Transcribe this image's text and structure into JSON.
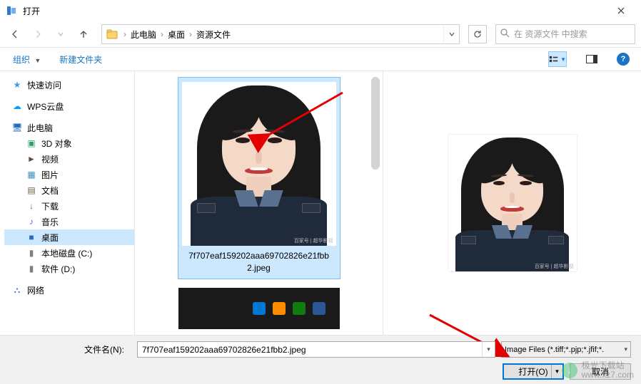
{
  "titlebar": {
    "title": "打开"
  },
  "nav": {
    "breadcrumb": [
      "此电脑",
      "桌面",
      "资源文件"
    ],
    "search_placeholder": "在 资源文件 中搜索"
  },
  "toolbar": {
    "organize": "组织",
    "new_folder": "新建文件夹"
  },
  "sidebar": {
    "items": [
      {
        "label": "快速访问",
        "color": "#3b9ae1",
        "glyph": "★",
        "level": 1
      },
      {
        "label": "WPS云盘",
        "color": "#00a0ff",
        "glyph": "☁",
        "level": 1
      },
      {
        "label": "此电脑",
        "color": "#2a6bbf",
        "glyph": "🖥",
        "level": 1
      },
      {
        "label": "3D 对象",
        "color": "#2aa36c",
        "glyph": "▣",
        "level": 2
      },
      {
        "label": "视频",
        "color": "#6b4a3b",
        "glyph": "►",
        "level": 2
      },
      {
        "label": "图片",
        "color": "#3c8fbf",
        "glyph": "▦",
        "level": 2
      },
      {
        "label": "文档",
        "color": "#6b5e3a",
        "glyph": "▤",
        "level": 2
      },
      {
        "label": "下载",
        "color": "#2a9a3a",
        "glyph": "↓",
        "level": 2
      },
      {
        "label": "音乐",
        "color": "#3a6fbf",
        "glyph": "♪",
        "level": 2
      },
      {
        "label": "桌面",
        "color": "#2a6bbf",
        "glyph": "■",
        "level": 2,
        "selected": true
      },
      {
        "label": "本地磁盘 (C:)",
        "color": "#7f7f7f",
        "glyph": "▮",
        "level": 2
      },
      {
        "label": "软件 (D:)",
        "color": "#7f7f7f",
        "glyph": "▮",
        "level": 2
      },
      {
        "label": "网络",
        "color": "#2a6bbf",
        "glyph": "⛬",
        "level": 1
      }
    ]
  },
  "content": {
    "selected_file_label": "7f707eaf159202aaa69702826e21fbb2.jpeg"
  },
  "bottom": {
    "filename_label": "文件名(N):",
    "filename_value": "7f707eaf159202aaa69702826e21fbb2.jpeg",
    "filter_label": "Image Files (*.tiff;*.pjp;*.jfif;*. ",
    "open_btn": "打开(O)",
    "cancel_btn": "取消"
  },
  "watermark": {
    "name": "极光下载站",
    "url": "www.xz7.com"
  }
}
